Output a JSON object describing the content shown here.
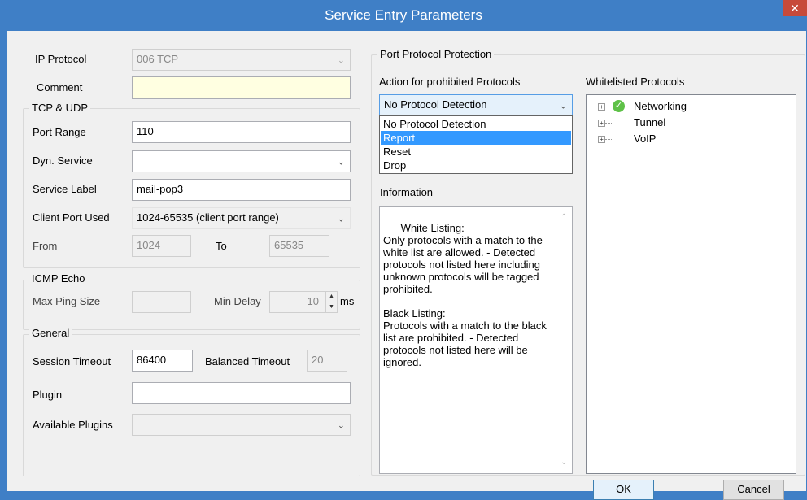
{
  "window": {
    "title": "Service Entry Parameters",
    "close_glyph": "✕"
  },
  "left": {
    "ip_protocol": {
      "label": "IP Protocol",
      "value": "006 TCP"
    },
    "comment": {
      "label": "Comment",
      "value": ""
    },
    "tcp_udp": {
      "title": "TCP & UDP",
      "port_range": {
        "label": "Port Range",
        "value": "110"
      },
      "dyn_service": {
        "label": "Dyn. Service",
        "value": ""
      },
      "service_label": {
        "label": "Service Label",
        "value": "mail-pop3"
      },
      "client_port_used": {
        "label": "Client Port Used",
        "value": "1024-65535 (client port range)"
      },
      "from": {
        "label": "From",
        "value": "1024"
      },
      "to": {
        "label": "To",
        "value": "65535"
      }
    },
    "icmp_echo": {
      "title": "ICMP Echo",
      "max_ping_size": {
        "label": "Max Ping Size",
        "value": ""
      },
      "min_delay": {
        "label": "Min Delay",
        "value": "10",
        "unit": "ms"
      }
    },
    "general": {
      "title": "General",
      "session_timeout": {
        "label": "Session Timeout",
        "value": "86400"
      },
      "balanced_timeout": {
        "label": "Balanced Timeout",
        "value": "20"
      },
      "plugin": {
        "label": "Plugin",
        "value": ""
      },
      "available_plugins": {
        "label": "Available Plugins",
        "value": ""
      }
    }
  },
  "right": {
    "group_title": "Port Protocol Protection",
    "action_label": "Action for prohibited Protocols",
    "action_selected": "No Protocol Detection",
    "action_options": [
      "No Protocol Detection",
      "Report",
      "Reset",
      "Drop"
    ],
    "highlighted_option_index": 1,
    "information_label": "Information",
    "information_text": "White Listing:\nOnly protocols with a match to the white list are allowed. - Detected protocols not listed here including unknown protocols will be tagged prohibited.\n\nBlack Listing:\nProtocols with a match to the black list are prohibited. - Detected protocols not listed here will be ignored.",
    "whitelisted_label": "Whitelisted Protocols",
    "whitelisted_items": [
      {
        "label": "Networking",
        "checked": true
      },
      {
        "label": "Tunnel",
        "checked": false
      },
      {
        "label": "VoIP",
        "checked": false
      }
    ]
  },
  "buttons": {
    "ok": "OK",
    "cancel": "Cancel"
  },
  "icons": {
    "close": "close-icon",
    "chevron": "chevron-down-icon",
    "check": "check-circle-icon",
    "expand": "tree-expand-icon"
  },
  "colors": {
    "titlebar": "#3f7fc6",
    "selection": "#3399ff",
    "close": "#c74a3a",
    "comment_bg": "#ffffe1",
    "check": "#5ec147"
  }
}
